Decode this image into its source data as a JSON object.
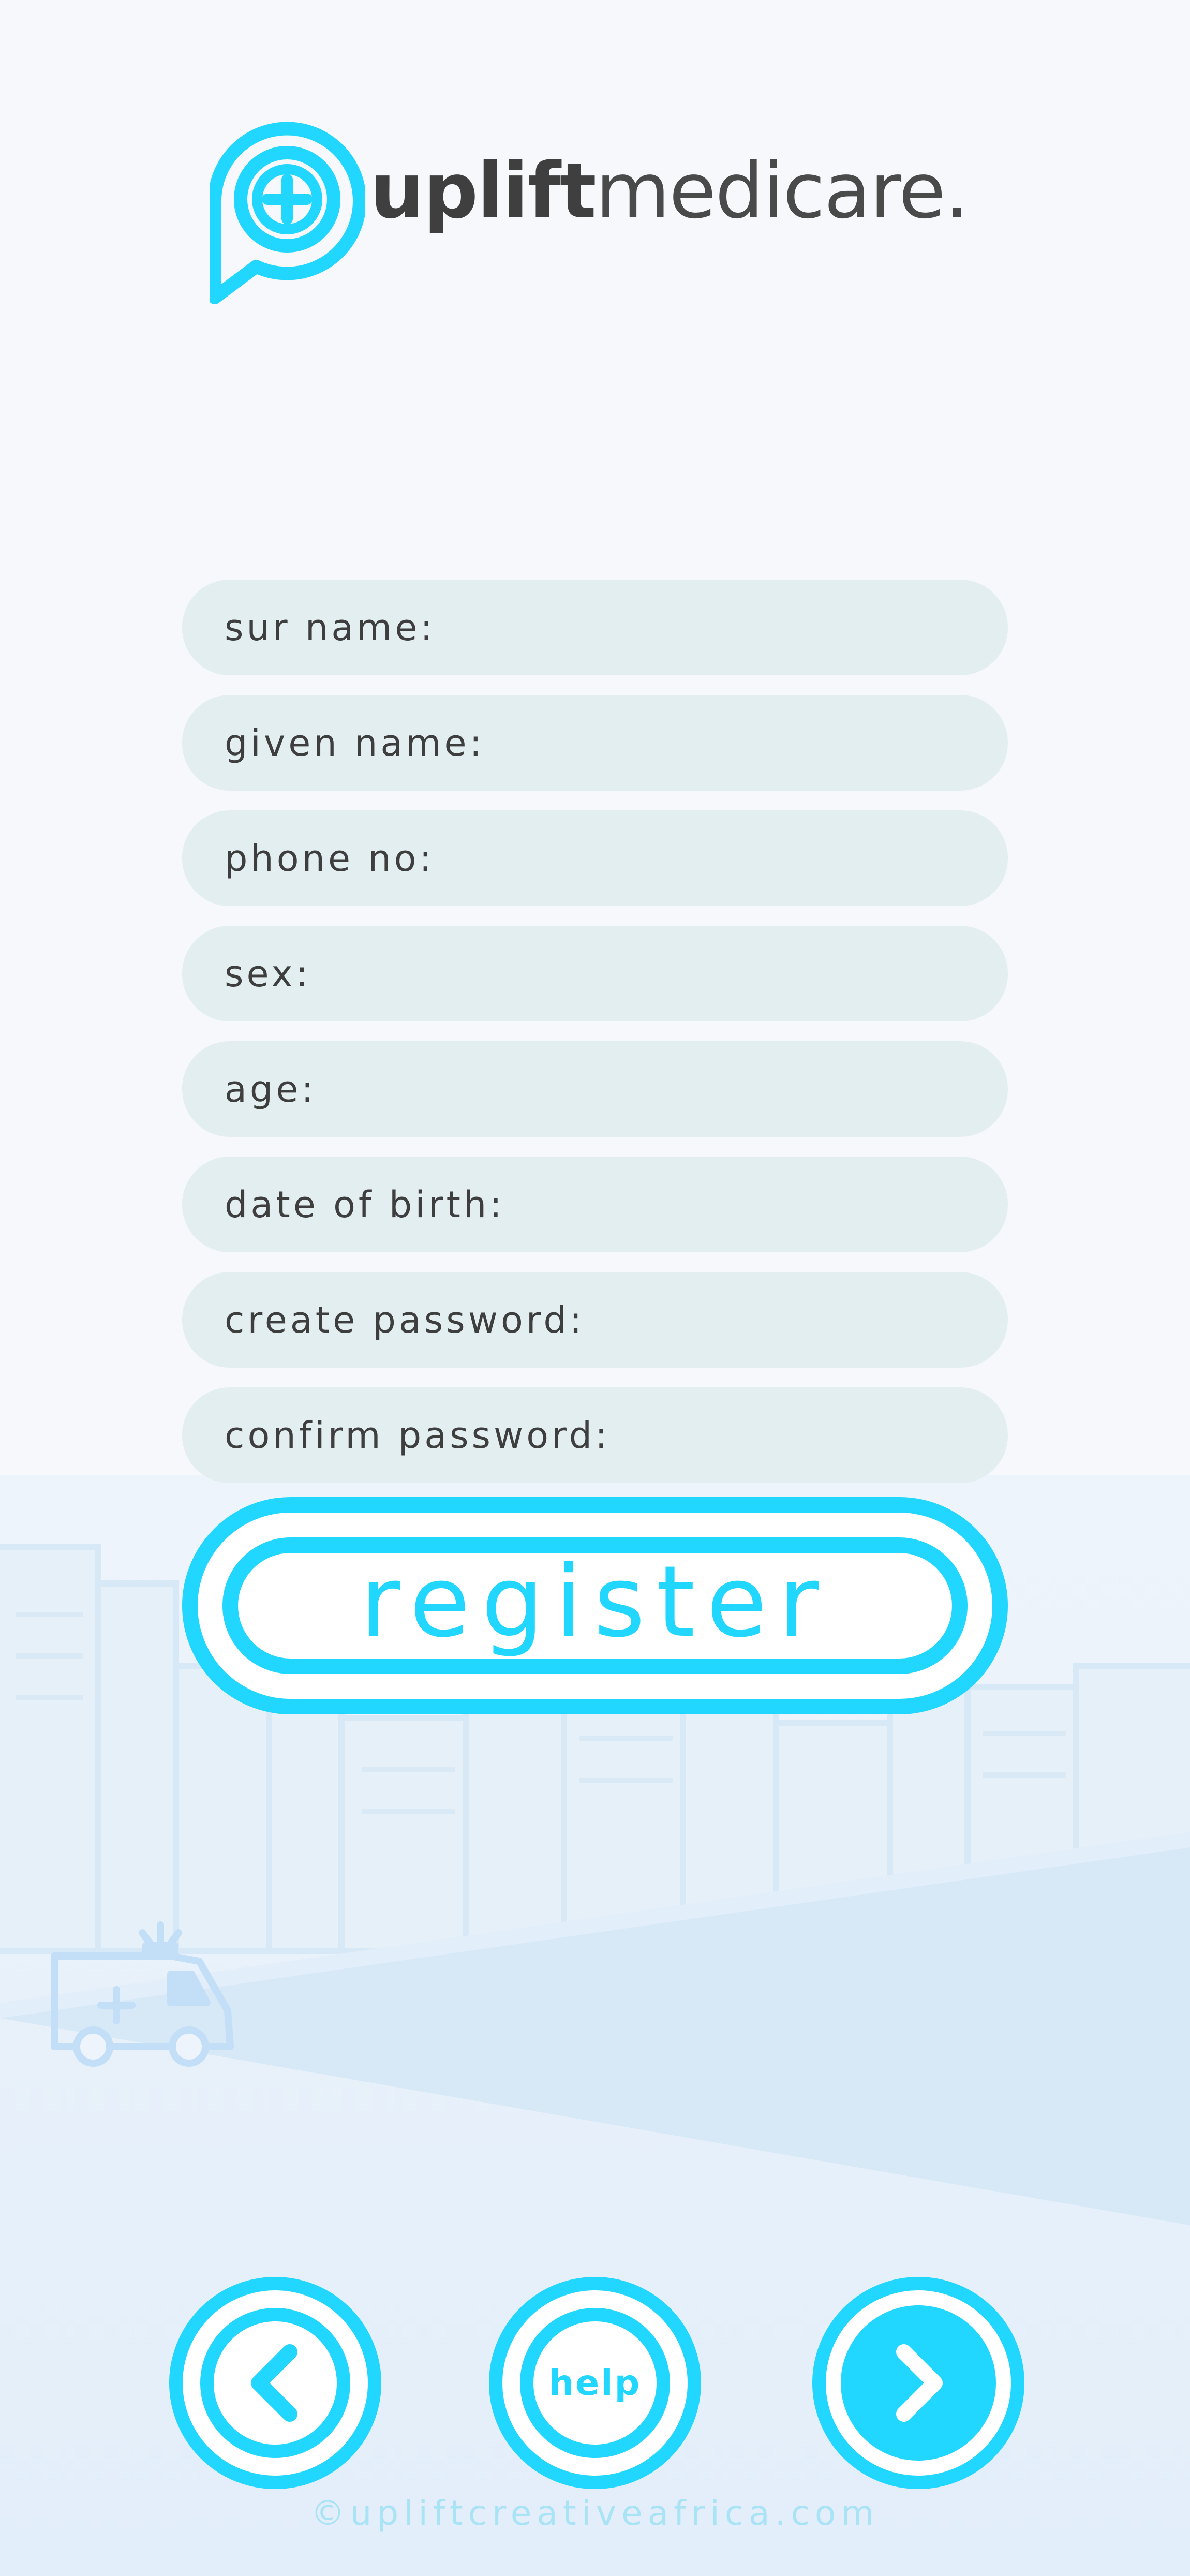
{
  "brand": {
    "name_bold": "uplift",
    "name_light": "medicare."
  },
  "form": {
    "fields": [
      {
        "label": "sur name:"
      },
      {
        "label": "given name:"
      },
      {
        "label": "phone no:"
      },
      {
        "label": "sex:"
      },
      {
        "label": "age:"
      },
      {
        "label": "date of birth:"
      },
      {
        "label": "create password:"
      },
      {
        "label": "confirm password:"
      }
    ],
    "register_label": "register"
  },
  "nav": {
    "back_icon": "chevron-left-icon",
    "help_label": "help",
    "next_icon": "chevron-right-icon"
  },
  "footer": {
    "text": "©upliftcreativeafrica.com"
  },
  "colors": {
    "accent": "#21d6ff",
    "field_bg": "#e3eef0",
    "text": "#3e3e3e",
    "background": "#f6f8fc"
  }
}
